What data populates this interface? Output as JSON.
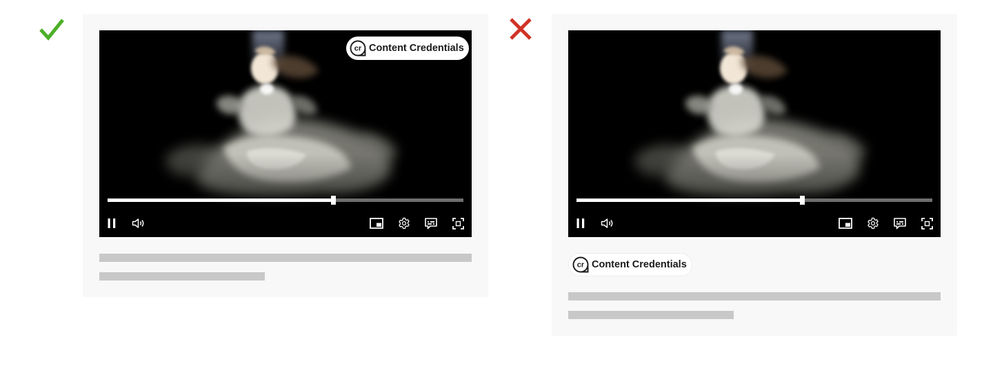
{
  "examples": [
    {
      "verdict": "do",
      "mark_icon": "checkmark-icon",
      "mark_color": "#4caf26",
      "badge_placement": "overlay-top-right",
      "badge": {
        "label": "Content Credentials",
        "logo_icon": "cr-logo-icon",
        "logo_text": "cr"
      },
      "player": {
        "progress": 0.633,
        "controls": [
          "pause-icon",
          "volume-icon",
          "picture-in-picture-icon",
          "settings-gear-icon",
          "captions-icon",
          "fullscreen-icon"
        ]
      },
      "text_placeholder_lines": 2
    },
    {
      "verdict": "dont",
      "mark_icon": "cross-icon",
      "mark_color": "#d03226",
      "badge_placement": "below-video",
      "badge": {
        "label": "Content Credentials",
        "logo_icon": "cr-logo-icon",
        "logo_text": "cr"
      },
      "player": {
        "progress": 0.633,
        "controls": [
          "pause-icon",
          "volume-icon",
          "picture-in-picture-icon",
          "settings-gear-icon",
          "captions-icon",
          "fullscreen-icon"
        ]
      },
      "text_placeholder_lines": 2
    }
  ],
  "colors": {
    "card_background": "#f8f8f8",
    "placeholder_line": "#c8c8c8",
    "video_background": "#000000"
  }
}
